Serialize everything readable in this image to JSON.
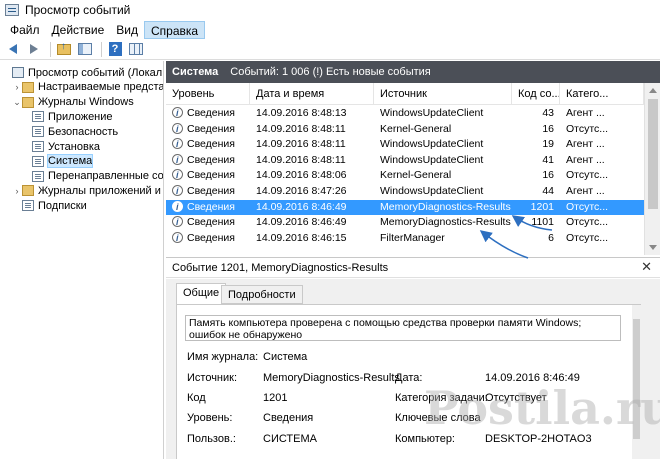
{
  "window": {
    "title": "Просмотр событий"
  },
  "menu": [
    "Файл",
    "Действие",
    "Вид",
    "Справка"
  ],
  "toolbar": {
    "icons": [
      "back-arrow",
      "forward-arrow",
      "folder-up",
      "show-tree",
      "help",
      "action-pane"
    ]
  },
  "tree": [
    {
      "label": "Просмотр событий (Локальны",
      "indent": 0,
      "expander": "",
      "icon": "event-viewer-icon"
    },
    {
      "label": "Настраиваемые представле",
      "indent": 1,
      "expander": "›",
      "icon": "folder-icon"
    },
    {
      "label": "Журналы Windows",
      "indent": 1,
      "expander": "⌄",
      "icon": "folder-icon"
    },
    {
      "label": "Приложение",
      "indent": 2,
      "expander": "",
      "icon": "log-icon"
    },
    {
      "label": "Безопасность",
      "indent": 2,
      "expander": "",
      "icon": "log-icon"
    },
    {
      "label": "Установка",
      "indent": 2,
      "expander": "",
      "icon": "log-icon"
    },
    {
      "label": "Система",
      "indent": 2,
      "expander": "",
      "icon": "log-icon",
      "selected": true
    },
    {
      "label": "Перенаправленные соб",
      "indent": 2,
      "expander": "",
      "icon": "log-icon"
    },
    {
      "label": "Журналы приложений и сл",
      "indent": 1,
      "expander": "›",
      "icon": "folder-icon"
    },
    {
      "label": "Подписки",
      "indent": 1,
      "expander": "",
      "icon": "log-icon"
    }
  ],
  "list_header": {
    "title": "Система",
    "summary": "Событий: 1 006 (!) Есть новые события"
  },
  "columns": [
    "Уровень",
    "Дата и время",
    "Источник",
    "Код со...",
    "Катего..."
  ],
  "rows": [
    {
      "level": "Сведения",
      "date": "14.09.2016 8:48:13",
      "source": "WindowsUpdateClient",
      "code": "43",
      "category": "Агент ..."
    },
    {
      "level": "Сведения",
      "date": "14.09.2016 8:48:11",
      "source": "Kernel-General",
      "code": "16",
      "category": "Отсутс..."
    },
    {
      "level": "Сведения",
      "date": "14.09.2016 8:48:11",
      "source": "WindowsUpdateClient",
      "code": "19",
      "category": "Агент ..."
    },
    {
      "level": "Сведения",
      "date": "14.09.2016 8:48:11",
      "source": "WindowsUpdateClient",
      "code": "41",
      "category": "Агент ..."
    },
    {
      "level": "Сведения",
      "date": "14.09.2016 8:48:06",
      "source": "Kernel-General",
      "code": "16",
      "category": "Отсутс..."
    },
    {
      "level": "Сведения",
      "date": "14.09.2016 8:47:26",
      "source": "WindowsUpdateClient",
      "code": "44",
      "category": "Агент ..."
    },
    {
      "level": "Сведения",
      "date": "14.09.2016 8:46:49",
      "source": "MemoryDiagnostics-Results",
      "code": "1201",
      "category": "Отсутс...",
      "selected": true
    },
    {
      "level": "Сведения",
      "date": "14.09.2016 8:46:49",
      "source": "MemoryDiagnostics-Results",
      "code": "1101",
      "category": "Отсутс..."
    },
    {
      "level": "Сведения",
      "date": "14.09.2016 8:46:15",
      "source": "FilterManager",
      "code": "6",
      "category": "Отсутс..."
    }
  ],
  "detail": {
    "title": "Событие 1201, MemoryDiagnostics-Results",
    "tabs": [
      "Общие",
      "Подробности"
    ],
    "description": "Память компьютера проверена с помощью средства проверки памяти Windows; ошибок не обнаружено",
    "labels": {
      "log_name": "Имя журнала:",
      "source": "Источник:",
      "code": "Код",
      "level": "Уровень:",
      "user": "Пользов.:",
      "date": "Дата:",
      "task_category": "Категория задачи:",
      "keywords": "Ключевые слова",
      "computer": "Компьютер:"
    },
    "values": {
      "log_name": "Система",
      "source": "MemoryDiagnostics-Results",
      "code": "1201",
      "level": "Сведения",
      "user": "СИСТЕМА",
      "date": "14.09.2016 8:46:49",
      "task_category": "Отсутствует",
      "keywords": "",
      "computer": "DESKTOP-2HOTAO3"
    }
  },
  "watermark": "Postila.ru",
  "colors": {
    "header_bar": "#4b4f57",
    "selection": "#3399ff",
    "annotation_arrows": "#2d6fc0"
  }
}
